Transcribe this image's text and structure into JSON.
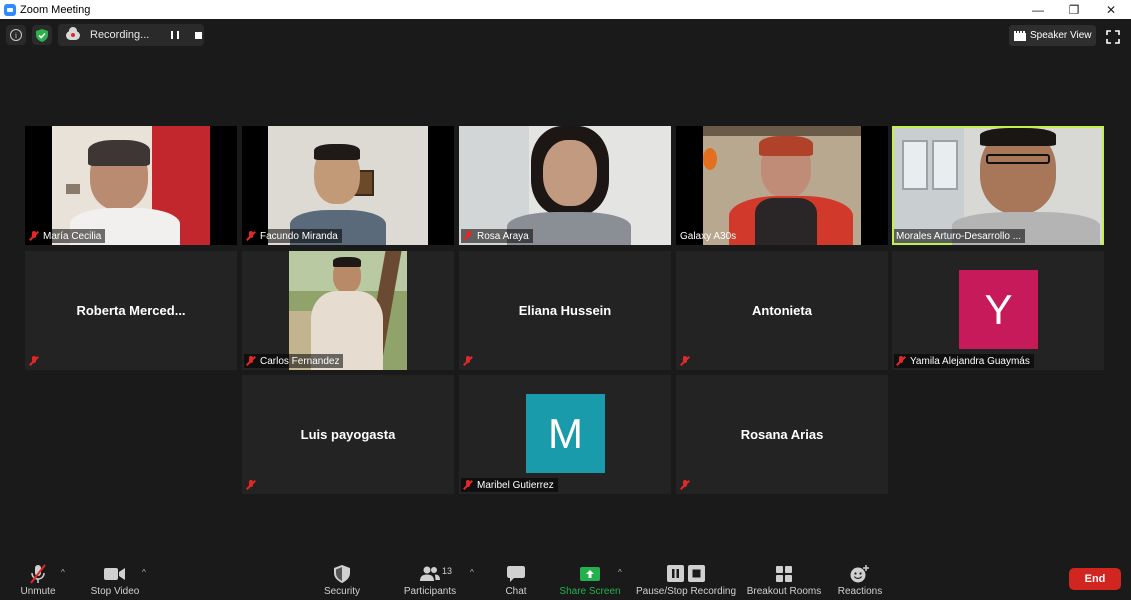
{
  "window": {
    "title": "Zoom Meeting"
  },
  "topbar": {
    "recording_label": "Recording...",
    "speaker_view_label": "Speaker View"
  },
  "participants": [
    {
      "name": "María Cecilia",
      "type": "video"
    },
    {
      "name": "Facundo Miranda",
      "type": "video"
    },
    {
      "name": "Rosa Araya",
      "type": "video"
    },
    {
      "name": "Galaxy A30s",
      "type": "video",
      "muted": false
    },
    {
      "name": "Morales Arturo-Desarrollo ...",
      "type": "video",
      "active_speaker": true
    },
    {
      "name": "Roberta  Merced...",
      "type": "name"
    },
    {
      "name": "Carlos Fernandez",
      "type": "video"
    },
    {
      "name": "Eliana Hussein",
      "type": "name"
    },
    {
      "name": "Antonieta",
      "type": "name"
    },
    {
      "name": "Yamila Alejandra Guaymás",
      "type": "avatar",
      "initial": "Y",
      "color": "#c71a5a"
    },
    {
      "name": "Luis payogasta",
      "type": "name"
    },
    {
      "name": "Maribel Gutierrez",
      "type": "avatar",
      "initial": "M",
      "color": "#1a9bab"
    },
    {
      "name": "Rosana Arias",
      "type": "name"
    }
  ],
  "toolbar": {
    "unmute": "Unmute",
    "stop_video": "Stop Video",
    "security": "Security",
    "participants": "Participants",
    "participants_count": "13",
    "chat": "Chat",
    "share_screen": "Share Screen",
    "recording": "Pause/Stop Recording",
    "breakout": "Breakout Rooms",
    "reactions": "Reactions",
    "end": "End"
  },
  "colors": {
    "active_speaker_border": "#c3f04a",
    "share_screen": "#22b14c",
    "end_button": "#d1261f",
    "muted_icon": "#e02828"
  }
}
